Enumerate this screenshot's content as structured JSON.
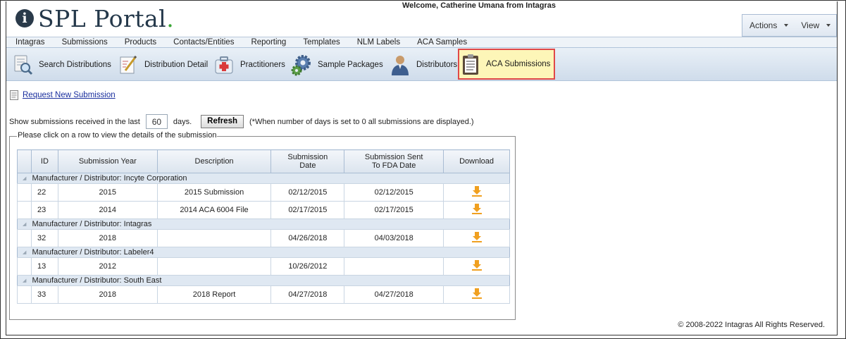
{
  "header": {
    "logo_text": "SPL Portal",
    "logo_dot": ".",
    "logo_i": "i",
    "welcome": "Welcome, Catherine Umana from Intagras",
    "menu": {
      "actions": "Actions",
      "view": "View"
    }
  },
  "nav": [
    "Intagras",
    "Submissions",
    "Products",
    "Contacts/Entities",
    "Reporting",
    "Templates",
    "NLM Labels",
    "ACA Samples"
  ],
  "toolbar": {
    "search_distributions": "Search Distributions",
    "distribution_detail": "Distribution Detail",
    "practitioners": "Practitioners",
    "sample_packages": "Sample Packages",
    "distributors": "Distributors",
    "aca_submissions": "ACA Submissions"
  },
  "request_link": "Request New Submission",
  "filter": {
    "prefix": "Show submissions received in the last",
    "days": "60",
    "suffix": "days.",
    "refresh": "Refresh",
    "note": "(*When number of days is set to 0 all submissions are displayed.)"
  },
  "legend": "Please click on a row to view the details of the submission",
  "table": {
    "headers": {
      "id": "ID",
      "year": "Submission Year",
      "description": "Description",
      "date_1": "Submission",
      "date_2": "Date",
      "sent_1": "Submission Sent",
      "sent_2": "To FDA Date",
      "download": "Download"
    },
    "groups": [
      {
        "label": "Manufacturer / Distributor: Incyte Corporation",
        "rows": [
          {
            "id": "22",
            "year": "2015",
            "description": "2015 Submission",
            "date": "02/12/2015",
            "sent": "02/12/2015"
          },
          {
            "id": "23",
            "year": "2014",
            "description": "2014 ACA 6004 File",
            "date": "02/17/2015",
            "sent": "02/17/2015"
          }
        ]
      },
      {
        "label": "Manufacturer / Distributor: Intagras",
        "rows": [
          {
            "id": "32",
            "year": "2018",
            "description": "",
            "date": "04/26/2018",
            "sent": "04/03/2018"
          }
        ]
      },
      {
        "label": "Manufacturer / Distributor: Labeler4",
        "rows": [
          {
            "id": "13",
            "year": "2012",
            "description": "",
            "date": "10/26/2012",
            "sent": ""
          }
        ]
      },
      {
        "label": "Manufacturer / Distributor: South East",
        "rows": [
          {
            "id": "33",
            "year": "2018",
            "description": "2018 Report",
            "date": "04/27/2018",
            "sent": "04/27/2018"
          }
        ]
      }
    ]
  },
  "footer": "© 2008-2022 Intagras All Rights Reserved.",
  "colors": {
    "brand_dark": "#24384a",
    "brand_green": "#3aa635",
    "active_border": "#e04848",
    "active_bg": "#fdf6b8",
    "download_orange": "#f0a020"
  }
}
